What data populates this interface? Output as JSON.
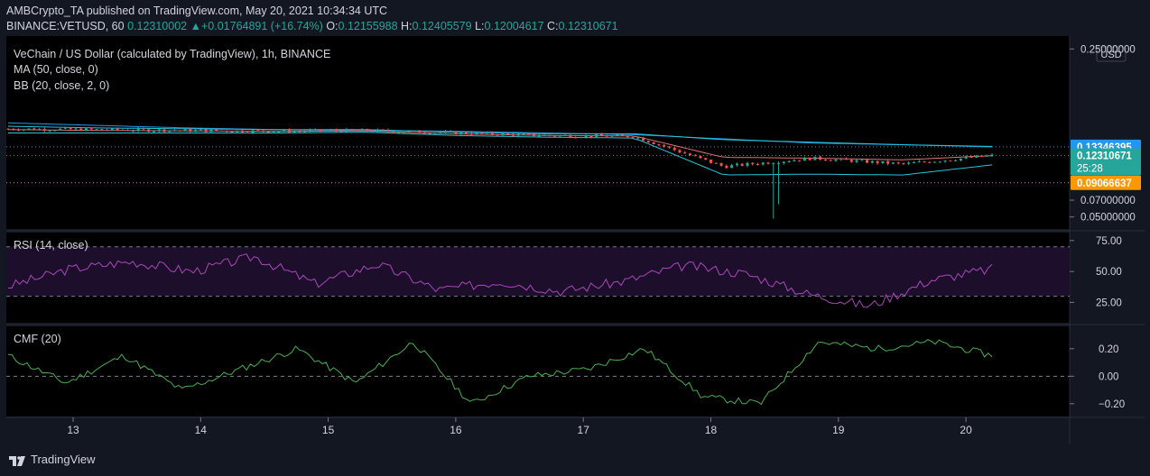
{
  "header": {
    "publisher": "AMBCrypto_TA",
    "published_text": "published on TradingView.com, May 20, 2021 10:34:34 UTC",
    "symbol": "BINANCE:VETUSD, 60",
    "last": "0.12310002",
    "change": "+0.01764891 (+16.74%)",
    "open_label": "O:",
    "open": "0.12155988",
    "high_label": "H:",
    "high": "0.12405579",
    "low_label": "L:",
    "low": "0.12004617",
    "close_label": "C:",
    "close": "0.12310671"
  },
  "legend": {
    "title": "VeChain / US Dollar (calculated by TradingView), 1h, BINANCE",
    "ma": "MA (50, close, 0)",
    "bb": "BB (20, close, 2, 0)",
    "rsi": "RSI (14, close)",
    "cmf": "CMF (20)"
  },
  "footer": {
    "brand": "TradingView"
  },
  "price_axis": {
    "currency": "USD",
    "ticks": [
      {
        "label": "0.25000000",
        "value": 0.25
      },
      {
        "label": "0.07000000",
        "value": 0.07
      },
      {
        "label": "0.05000000",
        "value": 0.05
      }
    ],
    "badges": [
      {
        "label": "0.13346395",
        "value": 0.13346395,
        "color": "#2196f3"
      },
      {
        "label": "0.12310671",
        "value": 0.12310671,
        "color": "#26a69a",
        "sub": "25:28"
      },
      {
        "label": "0.09066637",
        "value": 0.09066637,
        "color": "#ff9800"
      }
    ]
  },
  "rsi_axis": {
    "ticks": [
      {
        "label": "75.00",
        "value": 75
      },
      {
        "label": "50.00",
        "value": 50
      },
      {
        "label": "25.00",
        "value": 25
      }
    ]
  },
  "cmf_axis": {
    "ticks": [
      {
        "label": "0.20",
        "value": 0.2
      },
      {
        "label": "0.00",
        "value": 0
      },
      {
        "label": "−0.20",
        "value": -0.2
      }
    ]
  },
  "x_axis": {
    "labels": [
      "13",
      "14",
      "15",
      "16",
      "17",
      "18",
      "19",
      "20"
    ]
  },
  "colors": {
    "background": "#131722",
    "up": "#26a69a",
    "down": "#ef5350",
    "ma": "#2196f3",
    "bb_band": "#26c6da",
    "bb_basis": "#e57373",
    "rsi": "#ab47bc",
    "cmf": "#4caf50"
  },
  "chart_data": [
    {
      "type": "line",
      "title": "VeChain / US Dollar (calculated by TradingView), 1h, BINANCE",
      "x": [
        "May 12 18:00",
        "May 13 00:00",
        "May 14 00:00",
        "May 15 00:00",
        "May 16 00:00",
        "May 17 00:00",
        "May 18 00:00",
        "May 19 00:00",
        "May 19 12:00",
        "May 19 18:00",
        "May 20 00:00",
        "May 20 10:00"
      ],
      "series": [
        {
          "values": [
            0.155,
            0.154,
            0.153,
            0.152,
            0.153,
            0.15,
            0.147,
            0.146,
            0.11,
            0.12,
            0.113,
            0.1231
          ]
        },
        {
          "name": "MA (50, close, 0)",
          "values": [
            0.162,
            0.159,
            0.156,
            0.154,
            0.153,
            0.152,
            0.15,
            0.148,
            0.143,
            0.138,
            0.136,
            0.13346395
          ]
        },
        {
          "name": "BB (20, close, 2, 0)",
          "values": [
            0.158,
            0.156,
            0.155,
            0.154,
            0.154,
            0.151,
            0.149,
            0.149,
            0.142,
            0.139,
            0.136,
            0.134
          ]
        },
        {
          "name": "BB (20, close, 2, 0)",
          "values": [
            0.15,
            0.15,
            0.15,
            0.15,
            0.151,
            0.147,
            0.145,
            0.144,
            0.1,
            0.101,
            0.1,
            0.112
          ]
        }
      ],
      "candles_extremes": {
        "low": 0.048,
        "spike_low": 0.065
      },
      "ylim": [
        0.04,
        0.26
      ],
      "xlabel": "",
      "ylabel": ""
    },
    {
      "type": "line",
      "title": "RSI (14, close)",
      "x": [
        "13",
        "14",
        "15",
        "16",
        "17",
        "18",
        "19",
        "20"
      ],
      "series": [
        {
          "name": "RSI (14, close)",
          "values": [
            38,
            52,
            58,
            50,
            62,
            40,
            56,
            35,
            42,
            34,
            42,
            55,
            48,
            32,
            22,
            43,
            52
          ]
        }
      ],
      "levels": [
        70,
        30
      ],
      "ylim": [
        10,
        80
      ]
    },
    {
      "type": "line",
      "title": "CMF (20)",
      "x": [
        "13",
        "14",
        "15",
        "16",
        "17",
        "18",
        "19",
        "20"
      ],
      "series": [
        {
          "name": "CMF (20)",
          "values": [
            0.15,
            -0.05,
            0.15,
            -0.1,
            0.05,
            0.2,
            -0.05,
            0.25,
            -0.2,
            0.0,
            0.05,
            0.2,
            -0.15,
            -0.2,
            0.25,
            0.2,
            0.25,
            0.15
          ]
        }
      ],
      "ylim": [
        -0.28,
        0.35
      ]
    }
  ]
}
